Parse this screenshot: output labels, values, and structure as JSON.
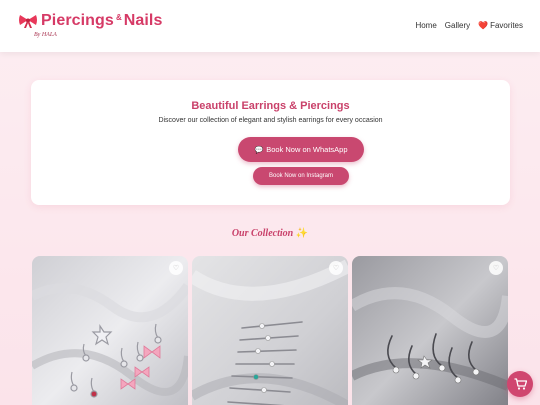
{
  "header": {
    "logo_main": "Piercings",
    "logo_amp": "&",
    "logo_second": "Nails",
    "logo_by": "By HALA",
    "nav": {
      "home": "Home",
      "gallery": "Gallery",
      "favorites": "Favorites"
    }
  },
  "hero": {
    "title": "Beautiful Earrings & Piercings",
    "subtitle": "Discover our collection of elegant and stylish earrings for every occasion",
    "whatsapp_label": "Book Now on WhatsApp",
    "instagram_label": "Book Now on Instagram"
  },
  "collection": {
    "title": "Our Collection",
    "sparkle": "✨"
  },
  "colors": {
    "accent": "#c94870",
    "brand": "#d63a66",
    "background": "#fdeef2"
  },
  "icons": {
    "logo": "bow-icon",
    "favorites": "heart-icon",
    "whatsapp": "chat-icon",
    "card_favorite": "heart-outline-icon",
    "cart": "cart-icon"
  }
}
